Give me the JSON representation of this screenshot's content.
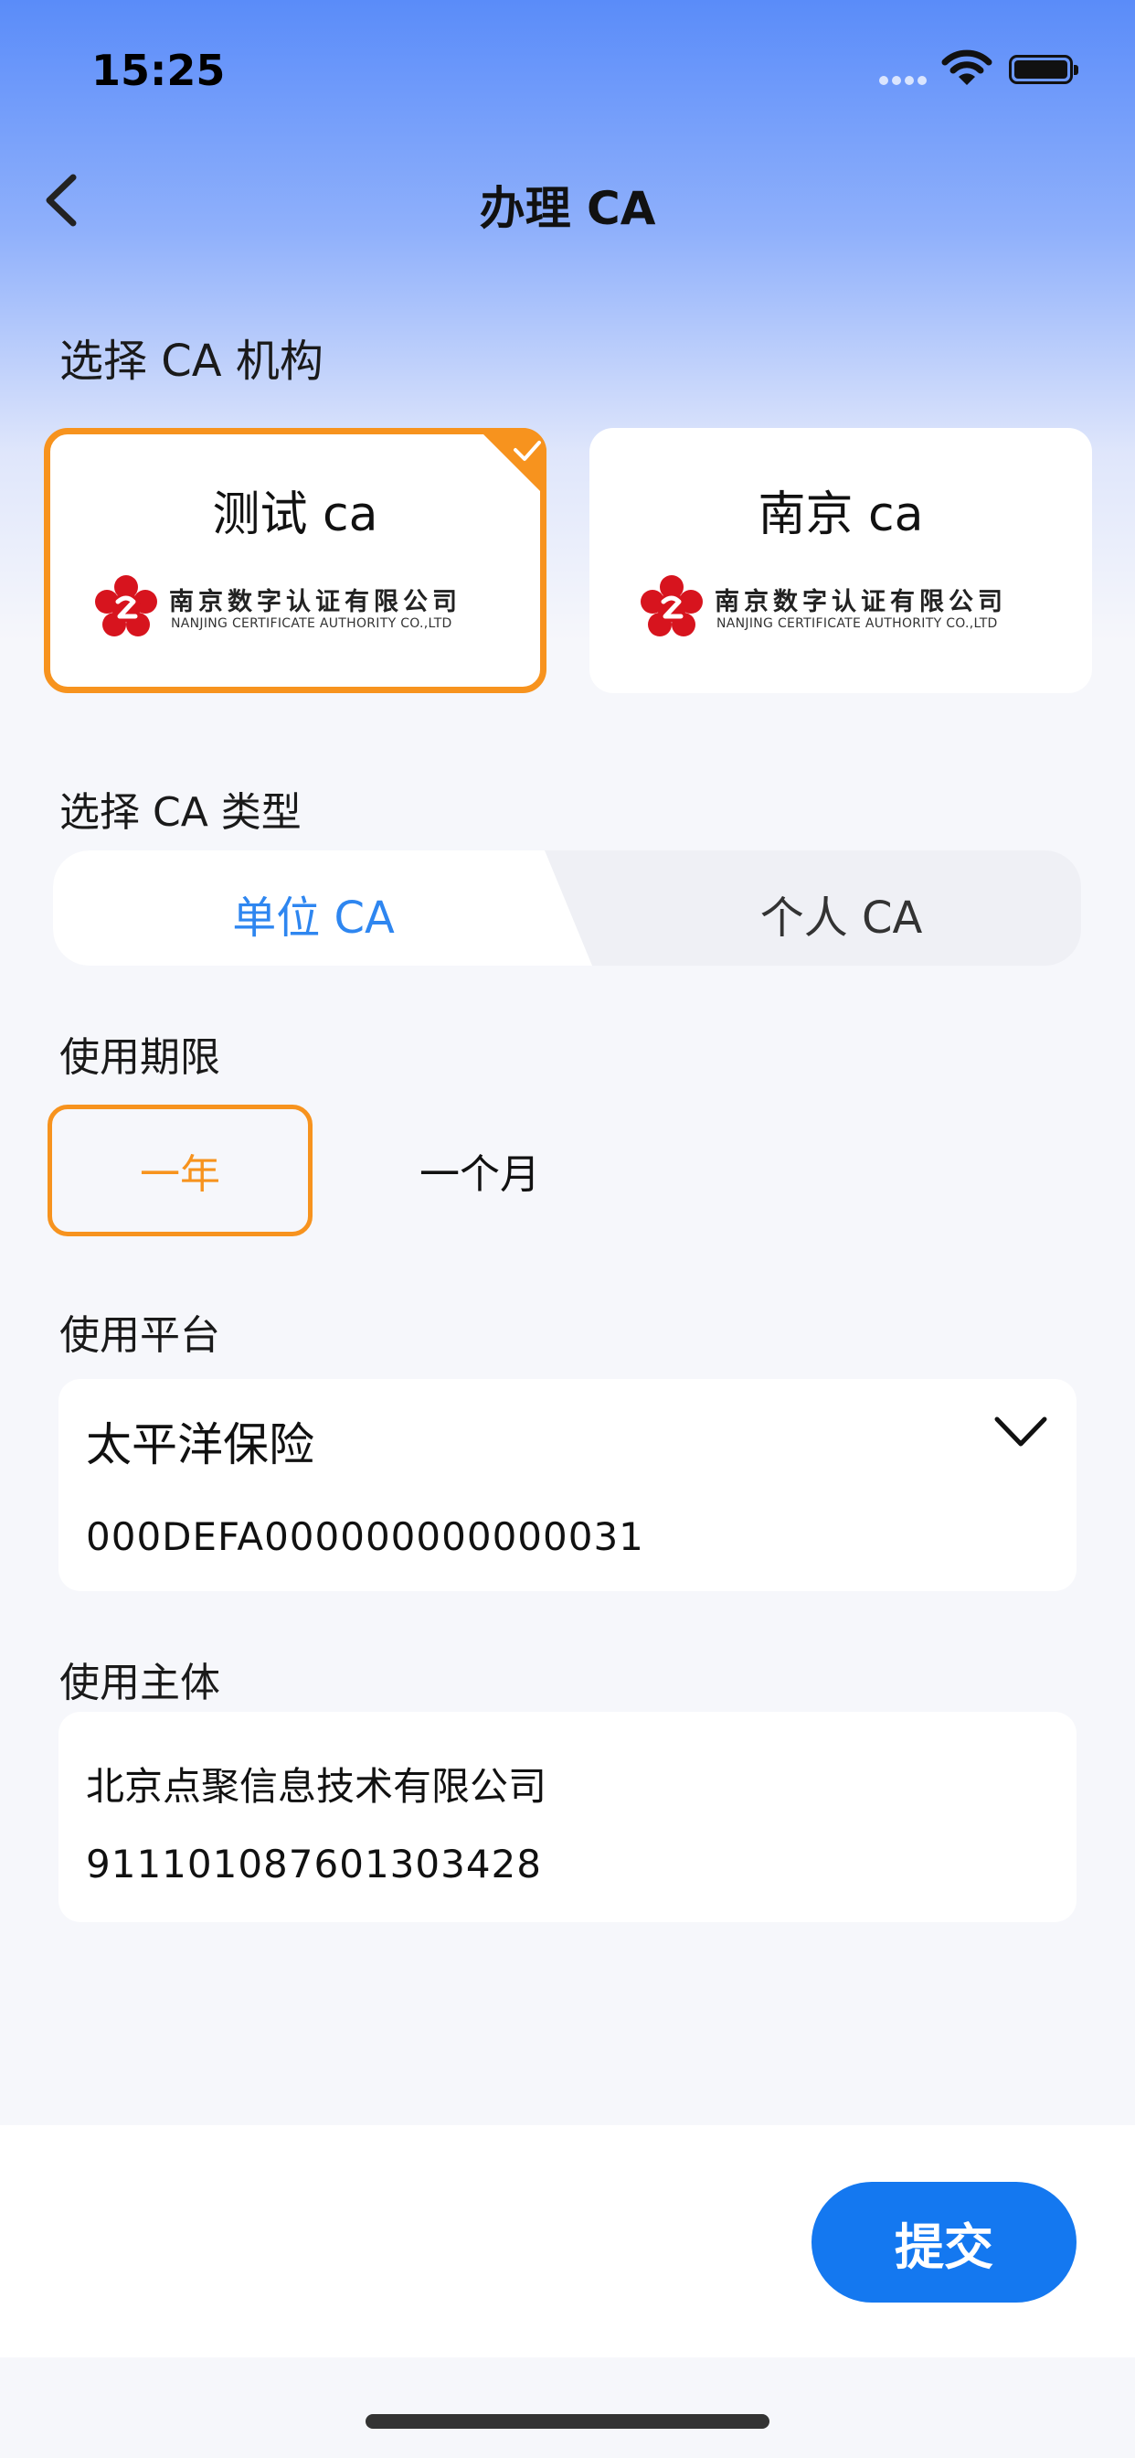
{
  "status_bar": {
    "time": "15:25"
  },
  "nav": {
    "title": "办理 CA"
  },
  "ca_org": {
    "label": "选择 CA 机构",
    "cards": [
      {
        "name": "测试 ca",
        "logo_zh": "南京数字认证有限公司",
        "logo_en": "NANJING CERTIFICATE AUTHORITY CO.,LTD",
        "selected": true
      },
      {
        "name": "南京 ca",
        "logo_zh": "南京数字认证有限公司",
        "logo_en": "NANJING CERTIFICATE AUTHORITY CO.,LTD",
        "selected": false
      }
    ]
  },
  "ca_type": {
    "label": "选择 CA 类型",
    "options": [
      {
        "label": "单位 CA",
        "selected": true
      },
      {
        "label": "个人 CA",
        "selected": false
      }
    ]
  },
  "period": {
    "label": "使用期限",
    "options": [
      {
        "label": "一年",
        "selected": true
      },
      {
        "label": "一个月",
        "selected": false
      }
    ]
  },
  "platform": {
    "label": "使用平台",
    "name": "太平洋保险",
    "code": "000DEFA000000000000031"
  },
  "subject": {
    "label": "使用主体",
    "name": "北京点聚信息技术有限公司",
    "code": "911101087601303428"
  },
  "actions": {
    "submit_label": "提交"
  },
  "colors": {
    "accent_orange": "#f7931e",
    "primary_blue": "#1478f0",
    "tab_blue": "#2e86f0"
  }
}
